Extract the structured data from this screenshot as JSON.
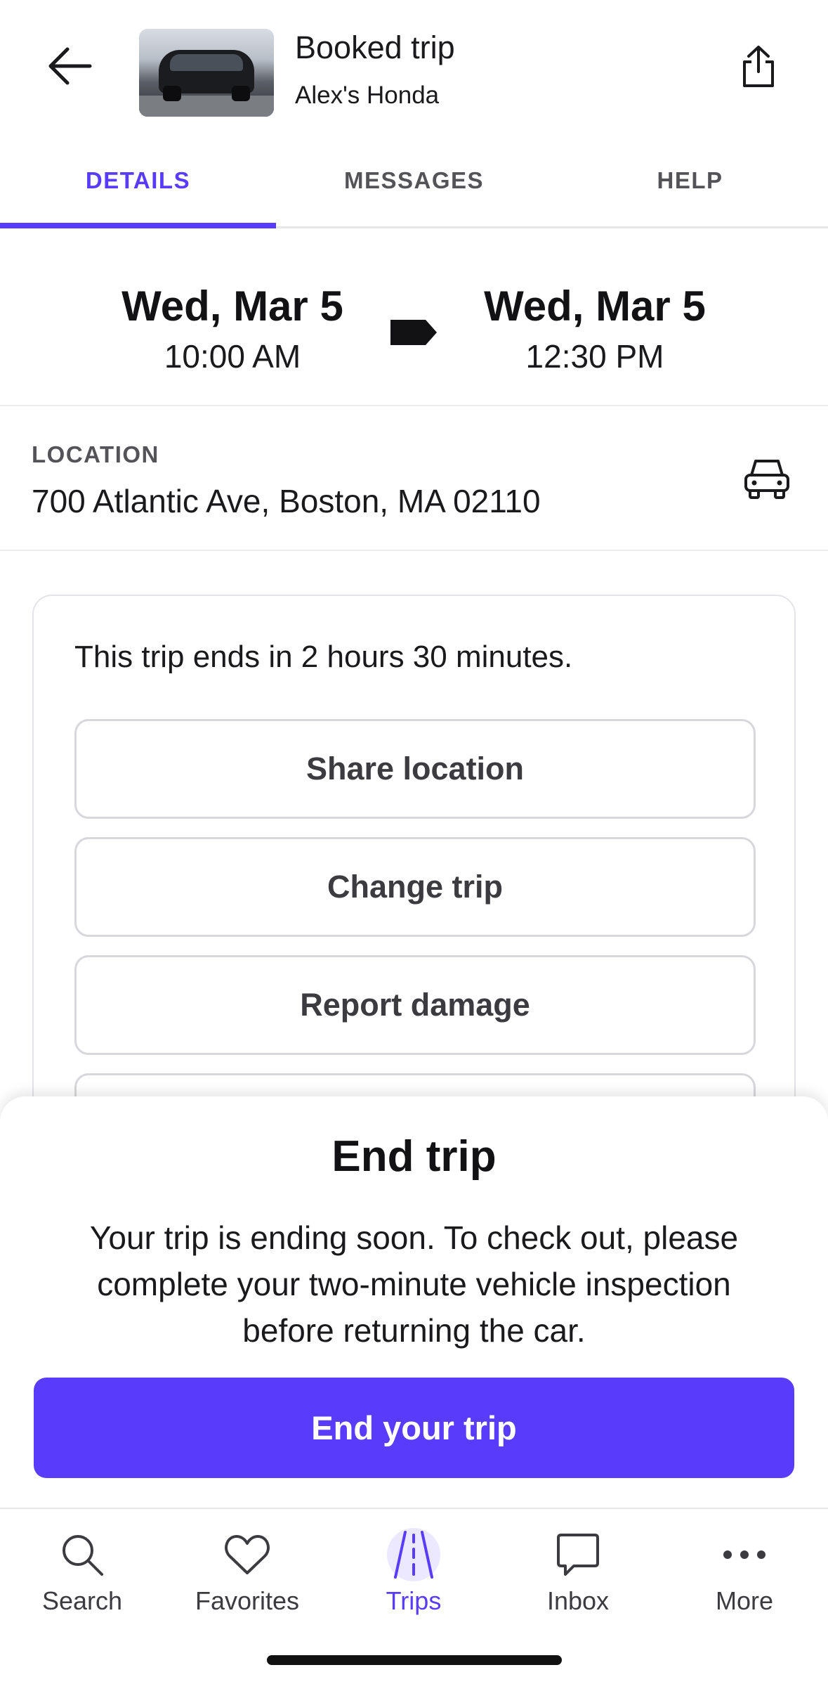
{
  "header": {
    "title": "Booked trip",
    "subtitle": "Alex's Honda"
  },
  "tabs": [
    {
      "label": "DETAILS",
      "active": true
    },
    {
      "label": "MESSAGES",
      "active": false
    },
    {
      "label": "HELP",
      "active": false
    }
  ],
  "trip": {
    "start_day": "Wed, Mar 5",
    "start_time": "10:00 AM",
    "end_day": "Wed, Mar 5",
    "end_time": "12:30 PM"
  },
  "location": {
    "label": "LOCATION",
    "address": "700 Atlantic Ave, Boston, MA 02110"
  },
  "card": {
    "message": "This trip ends in 2 hours 30 minutes.",
    "buttons": [
      "Share location",
      "Change trip",
      "Report damage"
    ]
  },
  "sheet": {
    "title": "End trip",
    "text": "Your trip is ending soon. To check out, please complete your two-minute vehicle inspection before returning the car.",
    "button": "End your trip"
  },
  "nav": {
    "items": [
      {
        "label": "Search",
        "icon": "search-icon"
      },
      {
        "label": "Favorites",
        "icon": "heart-icon"
      },
      {
        "label": "Trips",
        "icon": "road-icon",
        "active": true
      },
      {
        "label": "Inbox",
        "icon": "chat-icon"
      },
      {
        "label": "More",
        "icon": "more-icon"
      }
    ]
  },
  "colors": {
    "accent": "#593cfb",
    "text": "#121214",
    "muted": "#545458"
  }
}
